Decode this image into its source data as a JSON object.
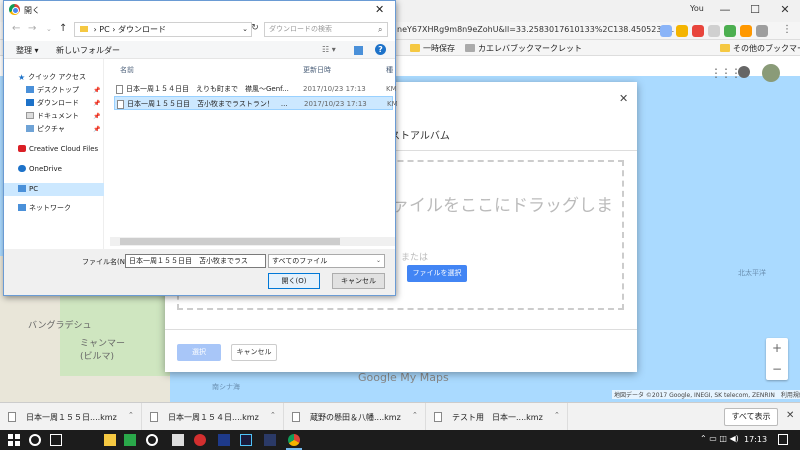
{
  "browser": {
    "user": "You",
    "window_controls": {
      "minimize": "—",
      "maximize": "☐",
      "close": "✕"
    },
    "url": "neY67XHRg9m8n9eZohU&ll=33.2583017610133%2C138.4505234...",
    "bookmarks": [
      "一時保存",
      "カエレバブックマークレット"
    ],
    "other_bookmarks": "その他のブックマーク"
  },
  "map": {
    "labels": {
      "bangladesh": "バングラデシュ",
      "myanmar": "ミャンマー\n(ビルマ)",
      "south_china_sea": "南シナ海",
      "pacific": "北太平洋"
    },
    "logo": "Google My Maps",
    "attribution": "地図データ ©2017 Google, INEGI, SK telecom, ZENRIN　利用規約",
    "zoom_in": "+",
    "zoom_out": "−"
  },
  "import_dialog": {
    "close": "✕",
    "tab_label": "ストアルバム",
    "drop_text": "ファイルをここにドラッグします",
    "or_text": "または",
    "select_file_label": "ファイルを選択",
    "select_label": "選択",
    "cancel_label": "キャンセル"
  },
  "open_dialog": {
    "title": "開く",
    "close": "✕",
    "breadcrumb": [
      "PC",
      "ダウンロード"
    ],
    "search_placeholder": "ダウンロードの検索",
    "toolbar": {
      "organize": "整理 ▾",
      "new_folder": "新しいフォルダー"
    },
    "help": "?",
    "nav": [
      {
        "label": "クイック アクセス",
        "pinned": false
      },
      {
        "label": "デスクトップ",
        "pinned": true
      },
      {
        "label": "ダウンロード",
        "pinned": true
      },
      {
        "label": "ドキュメント",
        "pinned": true
      },
      {
        "label": "ピクチャ",
        "pinned": true
      },
      {
        "label": "Creative Cloud Files",
        "pinned": false
      },
      {
        "label": "OneDrive",
        "pinned": false
      },
      {
        "label": "PC",
        "pinned": false
      },
      {
        "label": "ネットワーク",
        "pinned": false
      }
    ],
    "columns": {
      "name": "名前",
      "modified": "更新日時",
      "type": "種"
    },
    "files": [
      {
        "name": "日本一周１５４日目　えりも町まで　襟風〜Genf...",
        "modified": "2017/10/23 17:13",
        "type": "KM",
        "selected": false
      },
      {
        "name": "日本一周１５５日目　苫小牧までラストラン！　...",
        "modified": "2017/10/23 17:13",
        "type": "KM",
        "selected": true
      }
    ],
    "filename_label": "ファイル名(N):",
    "filename_value": "日本一周１５５日目　苫小牧までラス",
    "filter_value": "すべてのファイル",
    "open_label": "開く(O)",
    "cancel_label": "キャンセル"
  },
  "downloads": [
    {
      "name": "日本一周１５５日....kmz"
    },
    {
      "name": "日本一周１５４日....kmz"
    },
    {
      "name": "蔵野の懸田＆八幡....kmz"
    },
    {
      "name": "テスト用　日本一....kmz"
    }
  ],
  "show_all_label": "すべて表示",
  "shelf_close": "✕",
  "taskbar": {
    "time": "17:13"
  }
}
